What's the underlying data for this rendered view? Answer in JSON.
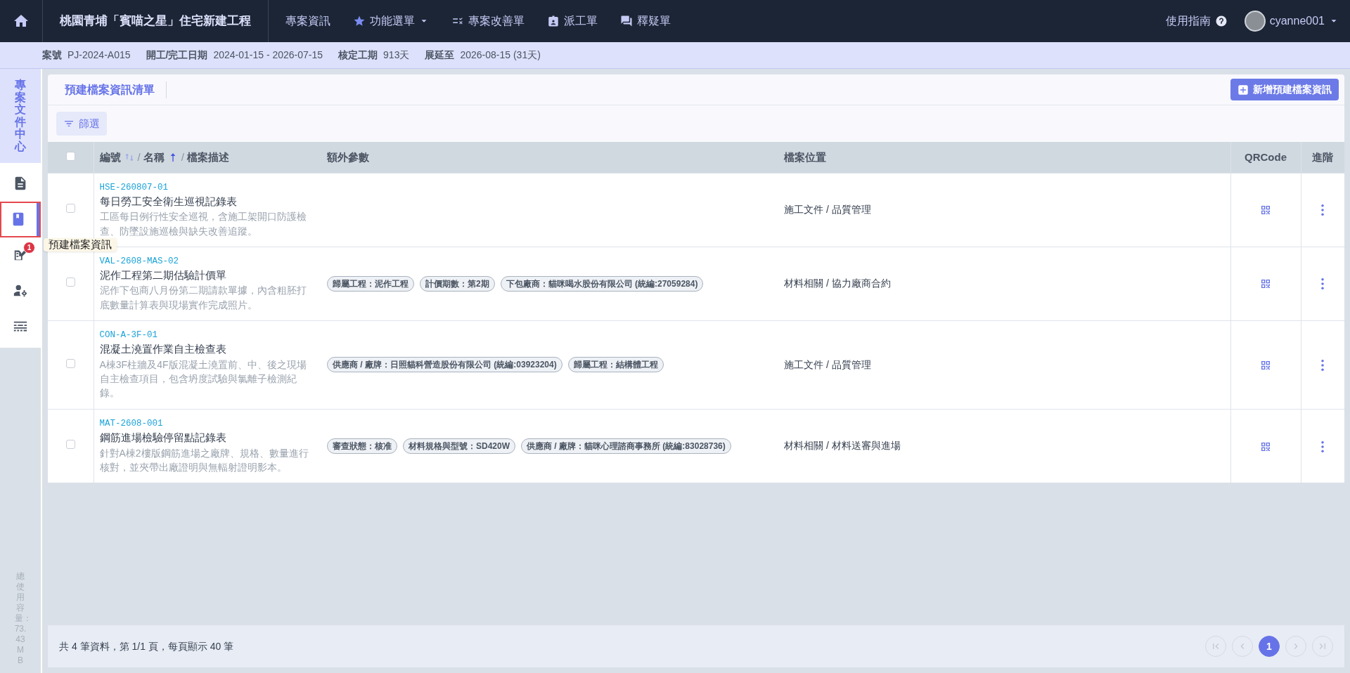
{
  "navbar": {
    "project_title": "桃園青埔「賓喵之星」住宅新建工程",
    "menu": [
      {
        "label": "專案資訊",
        "caret": false
      },
      {
        "label": "功能選單",
        "caret": true
      },
      {
        "label": "專案改善單",
        "caret": false
      },
      {
        "label": "派工單",
        "caret": false
      },
      {
        "label": "釋疑單",
        "caret": false
      }
    ],
    "guide": "使用指南",
    "user": "cyanne001"
  },
  "info_bar": [
    {
      "label": "案號",
      "value": "PJ-2024-A015"
    },
    {
      "label": "開工/完工日期",
      "value": "2024-01-15 - 2026-07-15"
    },
    {
      "label": "核定工期",
      "value": "913天"
    },
    {
      "label": "展延至",
      "value": "2026-08-15 (31天)"
    }
  ],
  "sidebar": {
    "title": "專案文件中心",
    "items": [
      {
        "selected": false
      },
      {
        "selected": true
      },
      {
        "selected": false,
        "badge": "1"
      },
      {
        "selected": false
      },
      {
        "selected": false
      }
    ],
    "tooltip": "預建檔案資訊",
    "usage": "總使用容量：73.43 MB"
  },
  "page": {
    "title": "預建檔案資訊清單",
    "add_button": "新增預建檔案資訊",
    "filter_button": "篩選"
  },
  "table": {
    "select_all_checked": false,
    "header_parts": [
      {
        "label": "編號",
        "sorted": false
      },
      {
        "prefix": "/",
        "label": "名稱",
        "sorted": true
      },
      {
        "prefix": "/",
        "label": "檔案描述"
      }
    ],
    "columns": [
      "額外參數",
      "檔案位置",
      "QRCode",
      "進階"
    ],
    "rows": [
      {
        "selected": false,
        "code": "HSE-260807-01",
        "name": "每日勞工安全衛生巡視記錄表",
        "description": "工區每日例行性安全巡視，含施工架開口防護檢查、防墜設施巡檢與缺失改善追蹤。",
        "params": [],
        "location": "施工文件 / 品質管理"
      },
      {
        "selected": false,
        "code": "VAL-2608-MAS-02",
        "name": "泥作工程第二期估驗計價單",
        "description": "泥作下包商八月份第二期請款單據，內含粗胚打底數量計算表與現場實作完成照片。",
        "params": [
          "歸屬工程：泥作工程",
          "計價期數：第2期",
          "下包廠商：貓咪喝水股份有限公司 (統編:27059284)"
        ],
        "location": "材料相關 / 協力廠商合約"
      },
      {
        "selected": false,
        "code": "CON-A-3F-01",
        "name": "混凝土澆置作業自主檢查表",
        "description": "A棟3F柱牆及4F版混凝土澆置前、中、後之現場自主檢查項目，包含坍度試驗與氯離子檢測紀錄。",
        "params": [
          "供應商 / 廠牌：日照貓科營造股份有限公司 (統編:03923204)",
          "歸屬工程：結構體工程"
        ],
        "location": "施工文件 / 品質管理"
      },
      {
        "selected": false,
        "code": "MAT-2608-001",
        "name": "鋼筋進場檢驗停留點記錄表",
        "description": "針對A棟2樓版鋼筋進場之廠牌、規格、數量進行核對，並夾帶出廠證明與無輻射證明影本。",
        "params": [
          "審查狀態：核准",
          "材料規格與型號：SD420W",
          "供應商 / 廠牌：貓咪心理諮商事務所 (統編:83028736)"
        ],
        "location": "材料相關 / 材料送審與進場"
      }
    ]
  },
  "footer": {
    "summary": "共 4 筆資料，第 1/1 頁，每頁顯示 40 筆",
    "pages": [
      {
        "label": "1",
        "selected": true
      }
    ]
  }
}
